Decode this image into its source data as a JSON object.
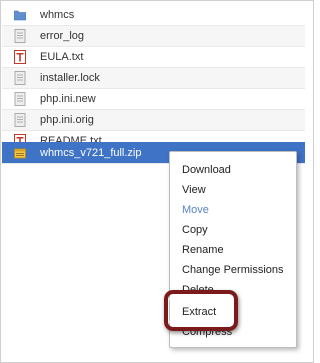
{
  "files": [
    {
      "name": "whmcs",
      "icon": "folder-icon"
    },
    {
      "name": "error_log",
      "icon": "text-file-icon"
    },
    {
      "name": "EULA.txt",
      "icon": "text-document-icon"
    },
    {
      "name": "installer.lock",
      "icon": "text-file-icon"
    },
    {
      "name": "php.ini.new",
      "icon": "text-file-icon"
    },
    {
      "name": "php.ini.orig",
      "icon": "text-file-icon"
    },
    {
      "name": "README.txt",
      "icon": "text-document-icon"
    },
    {
      "name": "whmcs_v721_full.zip",
      "icon": "archive-icon",
      "selected": true
    }
  ],
  "context_menu": {
    "items": [
      {
        "label": "Download"
      },
      {
        "label": "View"
      },
      {
        "label": "Move",
        "state": "disabled"
      },
      {
        "label": "Copy"
      },
      {
        "label": "Rename"
      },
      {
        "label": "Change Permissions"
      },
      {
        "label": "Delete"
      },
      {
        "label": "Extract",
        "state": "highlighted"
      },
      {
        "label": "Compress"
      }
    ]
  },
  "colors": {
    "selected_row": "#3f73c6",
    "highlight_ring": "#7a1a1a",
    "disabled_item": "#5a83c6"
  }
}
